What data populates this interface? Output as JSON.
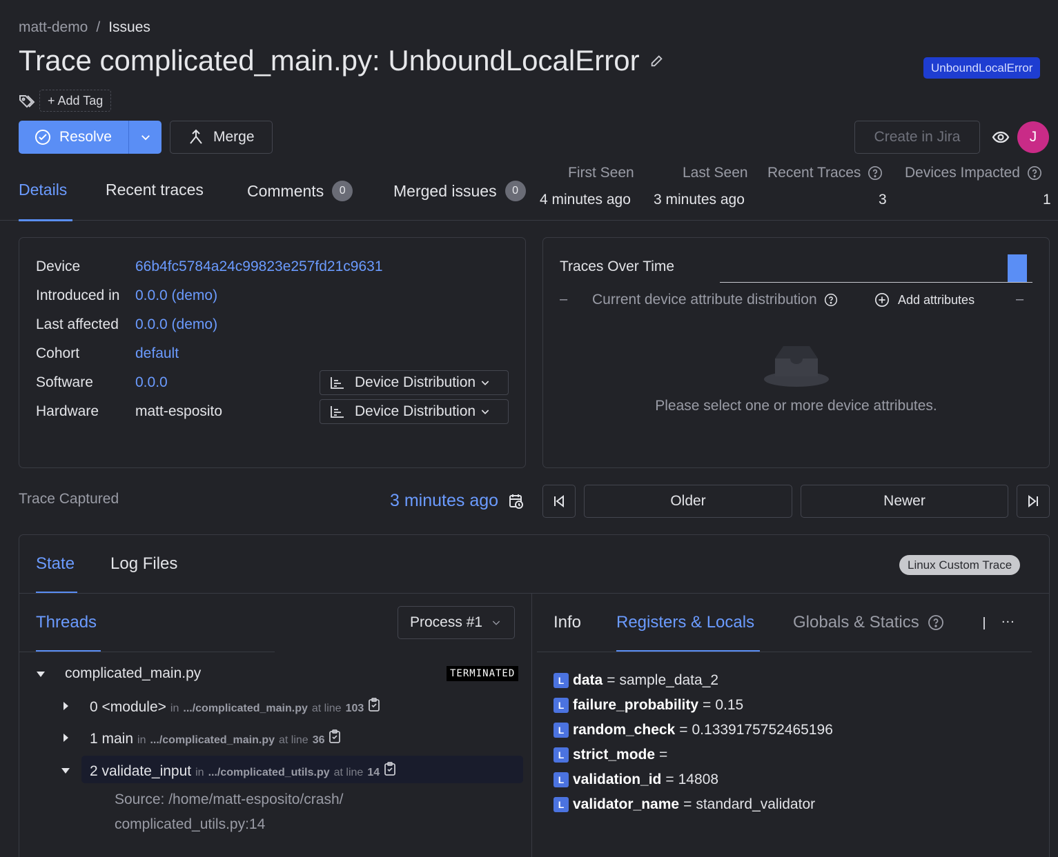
{
  "breadcrumb": {
    "project": "matt-demo",
    "separator": "/",
    "current": "Issues"
  },
  "title": "Trace complicated_main.py: UnboundLocalError",
  "error_badge": "UnboundLocalError",
  "add_tag": "+ Add Tag",
  "actions": {
    "resolve": "Resolve",
    "merge": "Merge",
    "create_jira": "Create in Jira",
    "avatar_initial": "J"
  },
  "tabs": [
    {
      "label": "Details",
      "active": true
    },
    {
      "label": "Recent traces"
    },
    {
      "label": "Comments",
      "count": "0"
    },
    {
      "label": "Merged issues",
      "count": "0"
    }
  ],
  "stats": {
    "first_seen_label": "First Seen",
    "first_seen": "4 minutes ago",
    "last_seen_label": "Last Seen",
    "last_seen": "3 minutes ago",
    "recent_traces_label": "Recent Traces",
    "recent_traces": "3",
    "devices_impacted_label": "Devices Impacted",
    "devices_impacted": "1"
  },
  "device_info": {
    "device_label": "Device",
    "device": "66b4fc5784a24c99823e257fd21c9631",
    "introduced_label": "Introduced in",
    "introduced": "0.0.0 (demo)",
    "last_affected_label": "Last affected",
    "last_affected": "0.0.0 (demo)",
    "cohort_label": "Cohort",
    "cohort": "default",
    "software_label": "Software",
    "software": "0.0.0",
    "hardware_label": "Hardware",
    "hardware": "matt-esposito",
    "distribution_button": "Device Distribution"
  },
  "traces_over_time": {
    "title": "Traces Over Time",
    "dash": "–",
    "attr_label": "Current device attribute distribution",
    "add_attributes": "Add attributes",
    "empty_text": "Please select one or more device attributes."
  },
  "trace_captured": {
    "label": "Trace Captured",
    "time": "3 minutes ago",
    "older": "Older",
    "newer": "Newer"
  },
  "state": {
    "tabs": [
      "State",
      "Log Files"
    ],
    "trace_type": "Linux Custom Trace",
    "threads_tab": "Threads",
    "process_select": "Process #1",
    "thread_name": "complicated_main.py",
    "thread_status": "TERMINATED",
    "frames": [
      {
        "name": "0 <module>",
        "in": "in",
        "file": ".../complicated_main.py",
        "at": "at line",
        "line": "103"
      },
      {
        "name": "1 main",
        "in": "in",
        "file": ".../complicated_main.py",
        "at": "at line",
        "line": "36"
      },
      {
        "name": "2 validate_input",
        "in": "in",
        "file": ".../complicated_utils.py",
        "at": "at line",
        "line": "14"
      }
    ],
    "source_line1": "Source: /home/matt-esposito/crash/",
    "source_line2": "complicated_utils.py:14",
    "right_tabs": [
      "Info",
      "Registers & Locals",
      "Globals & Statics"
    ],
    "more": "...",
    "locals": [
      {
        "badge": "L",
        "name": "data",
        "eq": "=",
        "value": "sample_data_2"
      },
      {
        "badge": "L",
        "name": "failure_probability",
        "eq": "=",
        "value": "0.15"
      },
      {
        "badge": "L",
        "name": "random_check",
        "eq": "=",
        "value": "0.1339175752465196"
      },
      {
        "badge": "L",
        "name": "strict_mode",
        "eq": "=",
        "value": ""
      },
      {
        "badge": "L",
        "name": "validation_id",
        "eq": "=",
        "value": "14808"
      },
      {
        "badge": "L",
        "name": "validator_name",
        "eq": "=",
        "value": "standard_validator"
      }
    ]
  },
  "colors": {
    "accent": "#5a8ef5",
    "link": "#6b9bff",
    "badge": "#1e3dd1",
    "avatar": "#c92b87",
    "background": "#222328"
  }
}
